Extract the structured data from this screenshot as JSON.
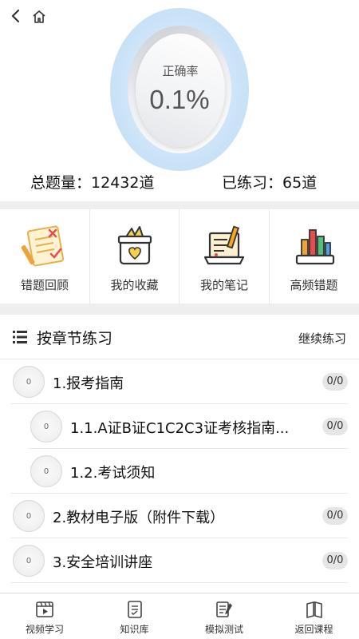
{
  "header": {
    "accuracy_label": "正确率",
    "accuracy_value": "0.1%",
    "total_label": "总题量：",
    "total_value": "12432道",
    "practiced_label": "已练习：",
    "practiced_value": "65道"
  },
  "tools": [
    {
      "label": "错题回顾",
      "icon": "wrong-questions-icon"
    },
    {
      "label": "我的收藏",
      "icon": "favorites-box-icon"
    },
    {
      "label": "我的笔记",
      "icon": "notes-laptop-icon"
    },
    {
      "label": "高频错题",
      "icon": "bar-chart-icon"
    }
  ],
  "chapter": {
    "title": "按章节练习",
    "continue_label": "继续练习"
  },
  "items": [
    {
      "title": "1.报考指南",
      "progress": "0",
      "score": "0/0",
      "level": 1
    },
    {
      "title": "1.1.A证B证C1C2C3证考核指南...",
      "progress": "0",
      "score": "0/0",
      "level": 2
    },
    {
      "title": "1.2.考试须知",
      "progress": "0",
      "score": "0/0",
      "level": 2
    },
    {
      "title": "2.教材电子版（附件下载）",
      "progress": "0",
      "score": "0/0",
      "level": 1
    },
    {
      "title": "3.安全培训讲座",
      "progress": "0",
      "score": "0/0",
      "level": 1
    }
  ],
  "bottom_nav": [
    {
      "label": "视频学习",
      "icon": "video-icon"
    },
    {
      "label": "知识库",
      "icon": "knowledge-icon"
    },
    {
      "label": "模拟测试",
      "icon": "mock-test-icon"
    },
    {
      "label": "返回课程",
      "icon": "book-icon"
    }
  ],
  "colors": {
    "gauge_glow": "#cfe5f8",
    "background_gap": "#eeeeee",
    "badge": "#e6e6e6"
  }
}
